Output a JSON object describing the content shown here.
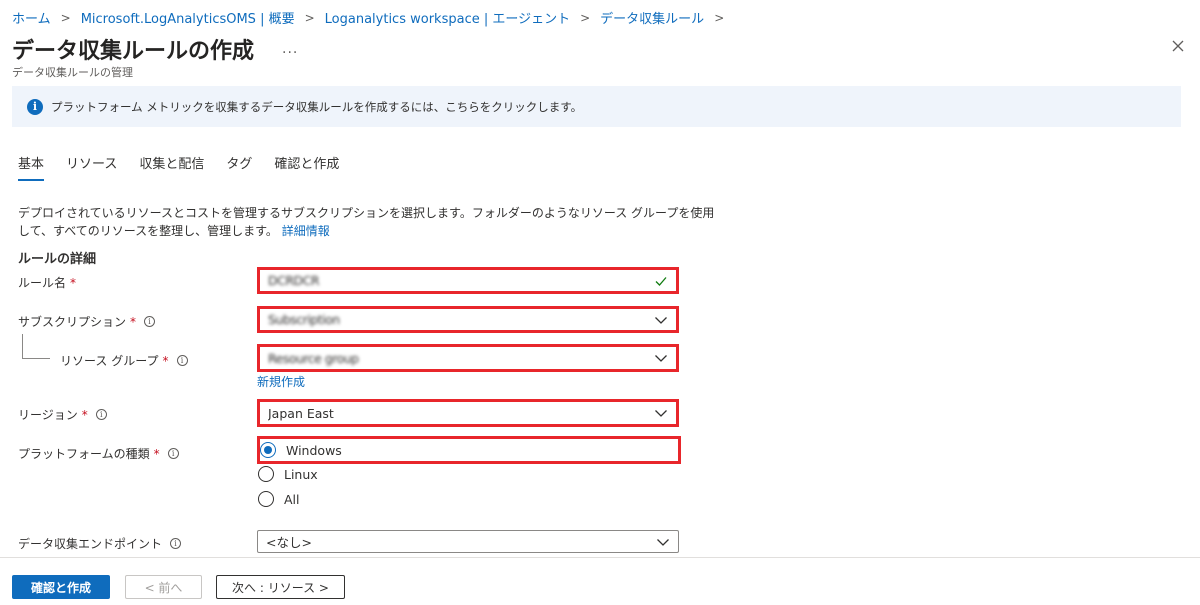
{
  "breadcrumb": [
    {
      "label": "ホーム"
    },
    {
      "label": "Microsoft.LogAnalyticsOMS | 概要"
    },
    {
      "label": "Loganalytics workspace | エージェント"
    },
    {
      "label": "データ収集ルール"
    }
  ],
  "header": {
    "title": "データ収集ルールの作成",
    "more": "...",
    "subtitle": "データ収集ルールの管理"
  },
  "banner": {
    "text": "プラットフォーム メトリックを収集するデータ収集ルールを作成するには、こちらをクリックします。"
  },
  "tabs": [
    {
      "label": "基本",
      "active": true
    },
    {
      "label": "リソース"
    },
    {
      "label": "収集と配信"
    },
    {
      "label": "タグ"
    },
    {
      "label": "確認と作成"
    }
  ],
  "description": {
    "text": "デプロイされているリソースとコストを管理するサブスクリプションを選択します。フォルダーのようなリソース グループを使用して、すべてのリソースを整理し、管理します。",
    "link": "詳細情報"
  },
  "section": {
    "title": "ルールの詳細"
  },
  "form": {
    "rule_name": {
      "label": "ルール名",
      "required": "*",
      "value": "DCRDCR"
    },
    "subscription": {
      "label": "サブスクリプション",
      "required": "*",
      "value": "Subscription"
    },
    "resource_group": {
      "label": "リソース グループ",
      "required": "*",
      "value": "Resource group",
      "new_link": "新規作成"
    },
    "region": {
      "label": "リージョン",
      "required": "*",
      "value": "Japan East"
    },
    "platform": {
      "label": "プラットフォームの種類",
      "required": "*",
      "options": [
        "Windows",
        "Linux",
        "All"
      ],
      "selected": "Windows"
    },
    "endpoint": {
      "label": "データ収集エンドポイント",
      "value": "<なし>"
    }
  },
  "footer": {
    "review_create": "確認と作成",
    "prev": "< 前へ",
    "next": "次へ : リソース >"
  },
  "colors": {
    "accent": "#0f6cbd",
    "highlight": "#e8262b",
    "required": "#c50f1f"
  }
}
